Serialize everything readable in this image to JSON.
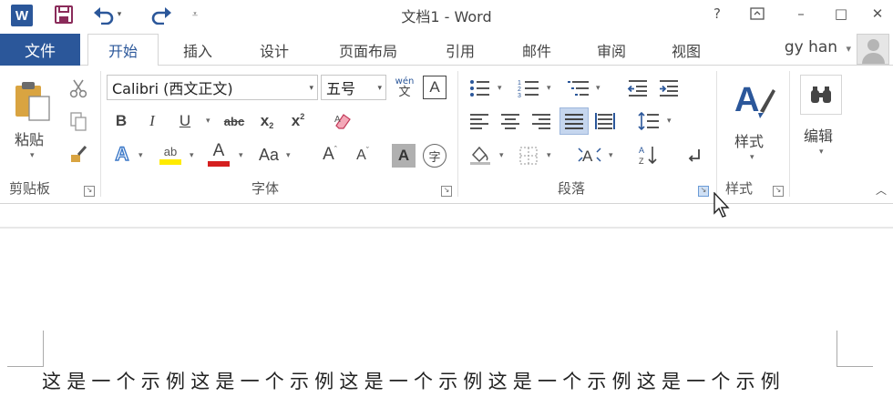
{
  "window": {
    "title": "文档1 - Word",
    "help": "?",
    "minimize": "–",
    "maximize": "□",
    "close": "✕"
  },
  "quick_access": {
    "app_icon_letter": "W",
    "save_icon": "save-icon",
    "undo_icon": "undo-icon",
    "redo_icon": "redo-icon",
    "customize_icon": "customize-qat-icon"
  },
  "tabs": {
    "file": "文件",
    "items": [
      "开始",
      "插入",
      "设计",
      "页面布局",
      "引用",
      "邮件",
      "审阅",
      "视图"
    ],
    "active": "开始"
  },
  "user": {
    "name": "gy han",
    "dropdown": "▾"
  },
  "ribbon": {
    "clipboard": {
      "label": "剪贴板",
      "paste": "粘贴"
    },
    "font": {
      "label": "字体",
      "font_name": "Calibri (西文正文)",
      "font_size": "五号",
      "phonetic_top": "wén",
      "phonetic_bottom": "文",
      "char_border": "A",
      "bold": "B",
      "italic": "I",
      "underline": "U",
      "strike": "abc",
      "subscript": "x",
      "superscript": "x",
      "text_effects": "A",
      "highlight": "ab",
      "font_color": "A",
      "change_case": "Aa",
      "grow": "A",
      "shrink": "A",
      "char_shading": "A",
      "enclose": "字"
    },
    "paragraph": {
      "label": "段落"
    },
    "styles": {
      "label": "样式",
      "button": "样式"
    },
    "editing": {
      "button": "编辑"
    }
  },
  "document": {
    "text": "这是一个示例这是一个示例这是一个示例这是一个示例这是一个示例"
  },
  "colors": {
    "brand": "#2b579a",
    "highlight_yellow": "#ffeb00",
    "font_red": "#d51f1f"
  }
}
